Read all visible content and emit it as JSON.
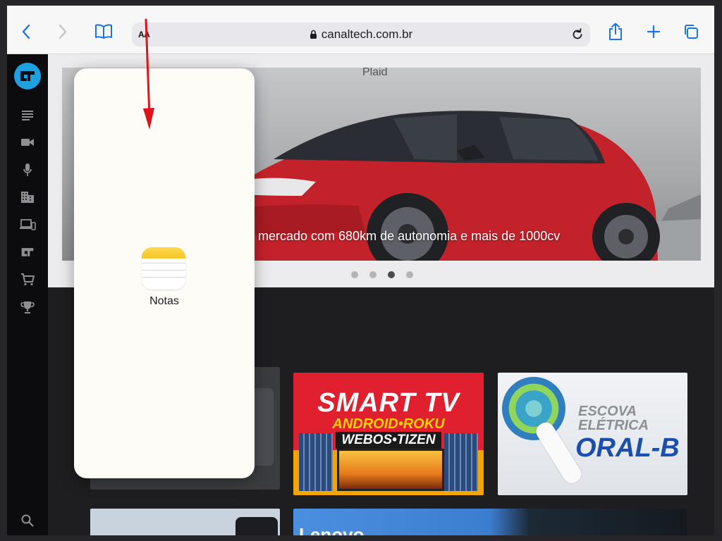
{
  "browser": {
    "reader_label": "AA",
    "url": "canaltech.com.br"
  },
  "hero": {
    "image_label": "Plaid",
    "caption": "mercado com 680km de autonomia e mais de 1000cv",
    "carousel_count": 4,
    "carousel_active": 3
  },
  "cards": {
    "smart_tv": {
      "title": "SMART TV",
      "line2": "ANDROID•ROKU",
      "line3": "WEBOS•TIZEN"
    },
    "oralb": {
      "line1": "ESCOVA",
      "line2": "ELÉTRICA",
      "brand": "ORAL-B"
    },
    "lenovo": {
      "text": "Lenovo"
    }
  },
  "slide_over": {
    "app_name": "Notas"
  },
  "colors": {
    "accent": "#1a73e8",
    "ct_brand": "#1da1e0",
    "annotation_arrow": "#e0121a"
  }
}
